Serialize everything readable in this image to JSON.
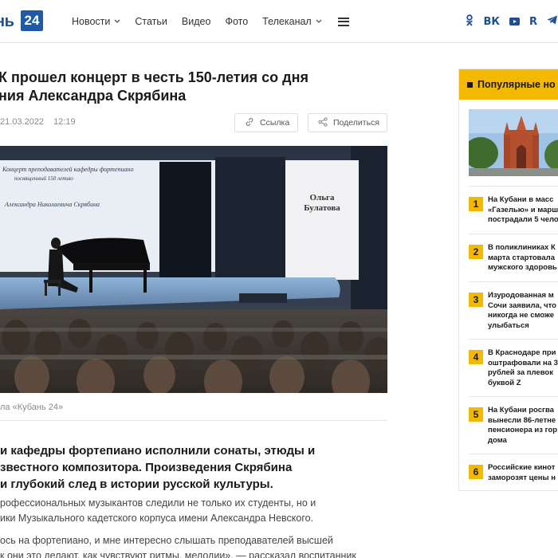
{
  "header": {
    "logo_text": "нь",
    "logo_number": "24",
    "nav": [
      {
        "label": "Новости",
        "has_dropdown": true
      },
      {
        "label": "Статьи",
        "has_dropdown": false
      },
      {
        "label": "Видео",
        "has_dropdown": false
      },
      {
        "label": "Фото",
        "has_dropdown": false
      },
      {
        "label": "Телеканал",
        "has_dropdown": true
      }
    ],
    "menu_icon": "hamburger-icon",
    "social": [
      "ok-icon",
      "vk-icon",
      "youtube-icon",
      "rutube-icon",
      "telegram-icon"
    ],
    "social_labels": {
      "vk": "ВК",
      "rutube": "R"
    }
  },
  "article": {
    "title_line1": "К прошел концерт в честь 150-летия со дня",
    "title_line2": "ния Александра Скрябина",
    "date": "21.03.2022",
    "time": "12:19",
    "link_button": "Ссылка",
    "share_button": "Поделиться",
    "photo": {
      "screen_text_line1": "Концерт преподавателей кафедры фортепиано",
      "screen_text_line2": "посвященный 150 летию",
      "screen_text_line3": "Александра Николаевича Скрябина",
      "name_line1": "Ольга",
      "name_line2": "Булатова"
    },
    "caption": "ла «Кубань 24»",
    "lead_line1": "и кафедры фортепиано исполнили сонаты, этюды и",
    "lead_line2": "звестного композитора. Произведения Скрябина",
    "lead_line3": "и глубокий след в истории русской культуры.",
    "para1_line1": "рофессиональных музыкантов следили не только их студенты, но и",
    "para1_line2": "ики Музыкального кадетского корпуса имени Александра Невского.",
    "para2_line1": "ось на фортепиано, и мне интересно слышать преподавателей высшей",
    "para2_line2": "к они это делают, как чувствуют ритмы, мелодии», — рассказал воспитанник"
  },
  "sidebar": {
    "title": "Популярные но",
    "items": [
      {
        "num": "1",
        "line1": "На Кубани в масс",
        "line2": "«Газелью» и марш",
        "line3": "пострадали 5 чело",
        "line4": ""
      },
      {
        "num": "2",
        "line1": "В поликлиниках К",
        "line2": "марта стартовала",
        "line3": "мужского здоровь",
        "line4": ""
      },
      {
        "num": "3",
        "line1": "Изуродованная м",
        "line2": "Сочи заявила, что",
        "line3": "никогда не сможе",
        "line4": "улыбаться"
      },
      {
        "num": "4",
        "line1": "В Краснодаре при",
        "line2": "оштрафовали на 3",
        "line3": "рублей за плевок",
        "line4": "буквой Z"
      },
      {
        "num": "5",
        "line1": "На Кубани росгва",
        "line2": "вынесли 86-летне",
        "line3": "пенсионера из гор",
        "line4": "дома"
      },
      {
        "num": "6",
        "line1": "Российские кинот",
        "line2": "заморозят цены н",
        "line3": "",
        "line4": ""
      }
    ]
  },
  "colors": {
    "accent": "#f3b800",
    "brand": "#1e5aa6",
    "text": "#1a1a1a",
    "muted": "#8a8a8a"
  }
}
